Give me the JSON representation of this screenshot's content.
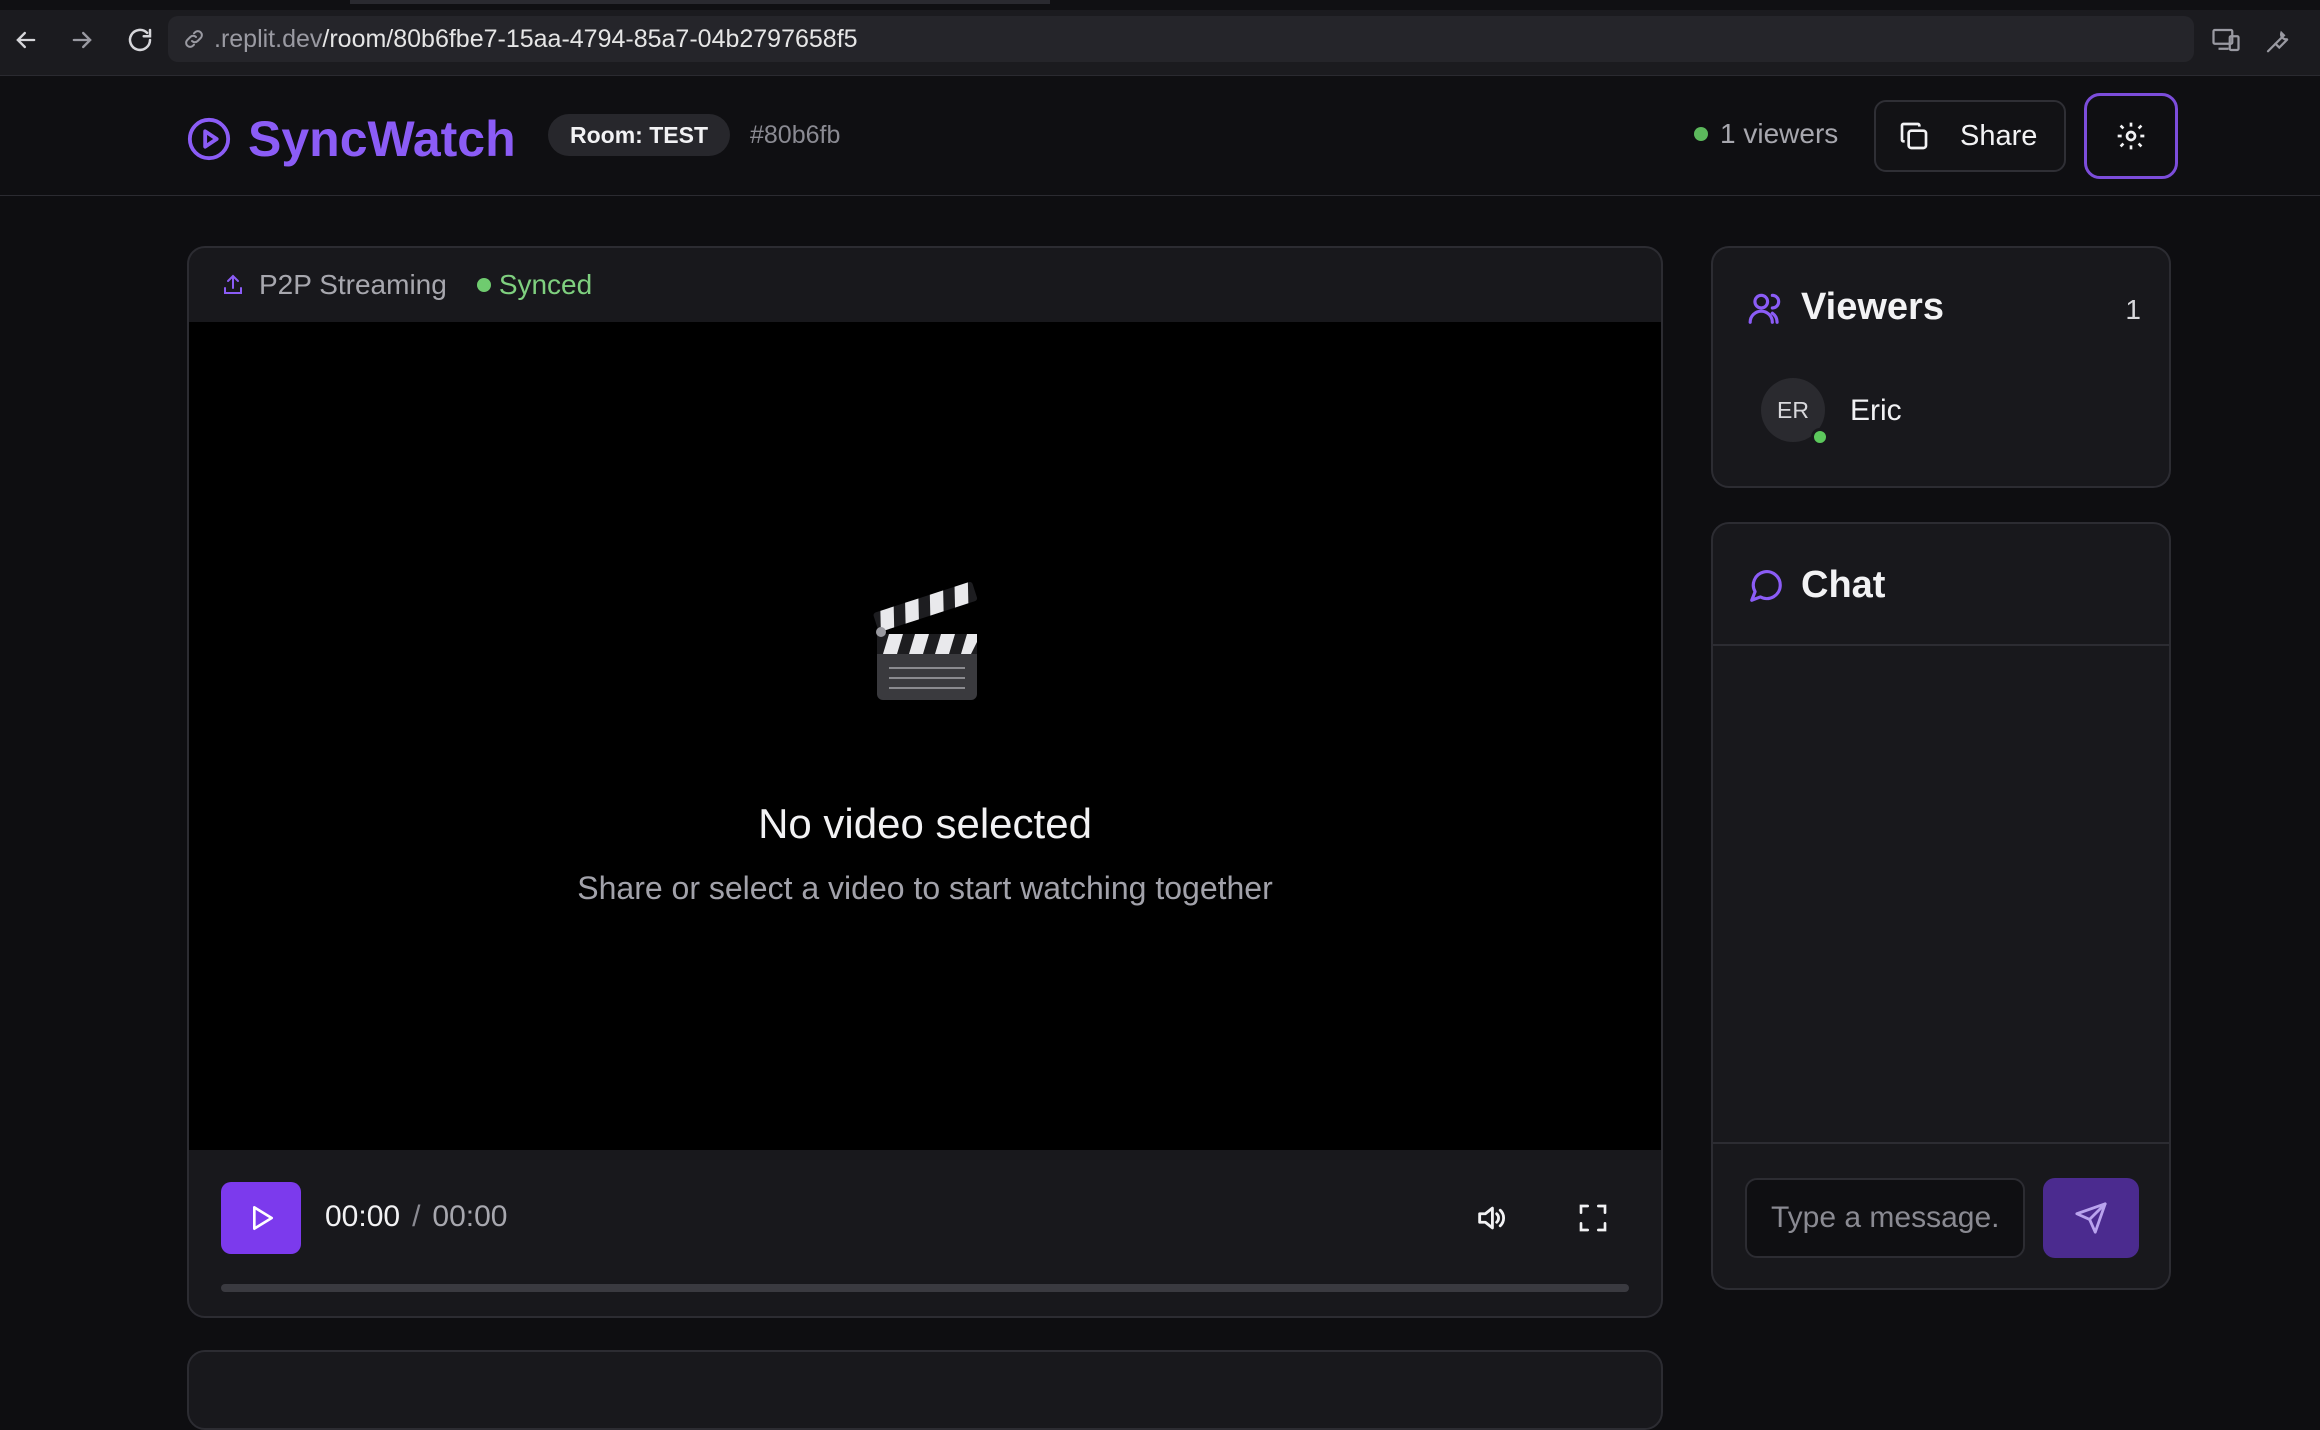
{
  "browser": {
    "url_prefix": ".replit.dev",
    "url_path": "/room/80b6fbe7-15aa-4794-85a7-04b2797658f5"
  },
  "header": {
    "app_name": "SyncWatch",
    "room_badge": "Room: TEST",
    "room_hash": "#80b6fb",
    "viewers_label": "1 viewers",
    "share_label": "Share"
  },
  "video": {
    "mode_label": "P2P Streaming",
    "sync_status": "Synced",
    "empty_title": "No video selected",
    "empty_subtitle": "Share or select a video to start watching together",
    "current_time": "00:00",
    "separator": "/",
    "duration": "00:00",
    "progress": 0
  },
  "viewers_panel": {
    "title": "Viewers",
    "count": "1",
    "viewers": [
      {
        "initials": "ER",
        "name": "Eric",
        "online": true
      }
    ]
  },
  "chat_panel": {
    "title": "Chat",
    "input_placeholder": "Type a message...",
    "messages": []
  },
  "colors": {
    "accent": "#8b5cf6",
    "online": "#5cb85c",
    "background": "#0e0e11"
  }
}
